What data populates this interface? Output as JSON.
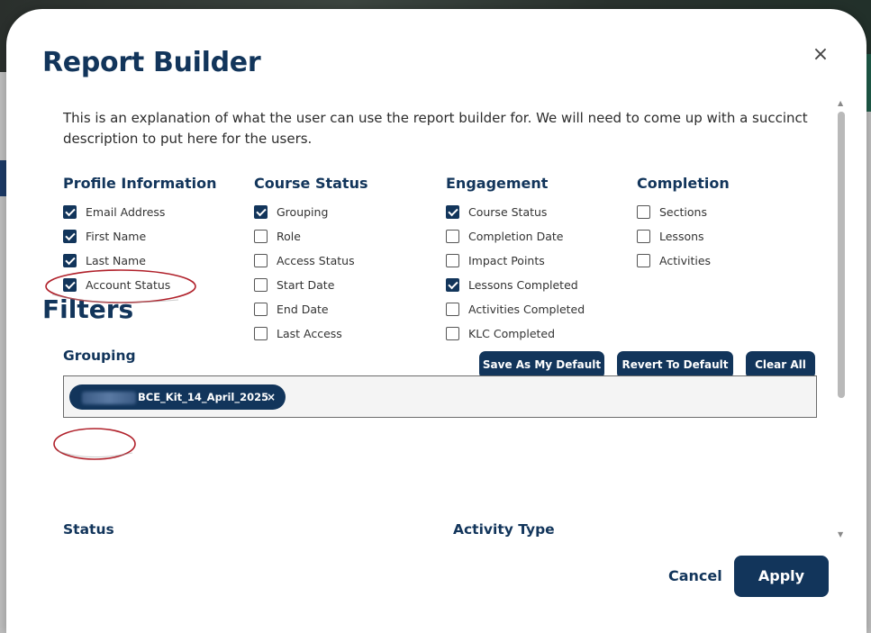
{
  "modal": {
    "title": "Report Builder",
    "close_glyph": "×",
    "description": "This is an explanation of what the user can use the report builder for. We will need to come up with a succinct description to put here for the users."
  },
  "columns": [
    {
      "title": "Profile Information",
      "items": [
        {
          "label": "Email Address",
          "checked": true
        },
        {
          "label": "First Name",
          "checked": true
        },
        {
          "label": "Last Name",
          "checked": true
        },
        {
          "label": "Account Status",
          "checked": true
        }
      ]
    },
    {
      "title": "Course Status",
      "items": [
        {
          "label": "Grouping",
          "checked": true
        },
        {
          "label": "Role",
          "checked": false
        },
        {
          "label": "Access Status",
          "checked": false
        },
        {
          "label": "Start Date",
          "checked": false
        },
        {
          "label": "End Date",
          "checked": false
        },
        {
          "label": "Last Access",
          "checked": false
        }
      ]
    },
    {
      "title": "Engagement",
      "items": [
        {
          "label": "Course Status",
          "checked": true
        },
        {
          "label": "Completion Date",
          "checked": false
        },
        {
          "label": "Impact Points",
          "checked": false
        },
        {
          "label": "Lessons Completed",
          "checked": true
        },
        {
          "label": "Activities Completed",
          "checked": false
        },
        {
          "label": "KLC Completed",
          "checked": false
        }
      ]
    },
    {
      "title": "Completion",
      "items": [
        {
          "label": "Sections",
          "checked": false
        },
        {
          "label": "Lessons",
          "checked": false
        },
        {
          "label": "Activities",
          "checked": false
        }
      ]
    }
  ],
  "actions": {
    "save_default": "Save As My Default",
    "revert_default": "Revert To Default",
    "clear_all": "Clear All"
  },
  "filters": {
    "title": "Filters",
    "grouping_label": "Grouping",
    "grouping_chip": "BCE_Kit_14_April_2025",
    "chip_remove_glyph": "×",
    "status_label": "Status",
    "activity_type_label": "Activity Type"
  },
  "footer": {
    "cancel": "Cancel",
    "apply": "Apply"
  },
  "colors": {
    "primary": "#12355b",
    "annotation": "#b0202a"
  },
  "icons": {
    "close": "close-icon",
    "check": "checkmark-icon",
    "chip_remove": "close-icon"
  }
}
